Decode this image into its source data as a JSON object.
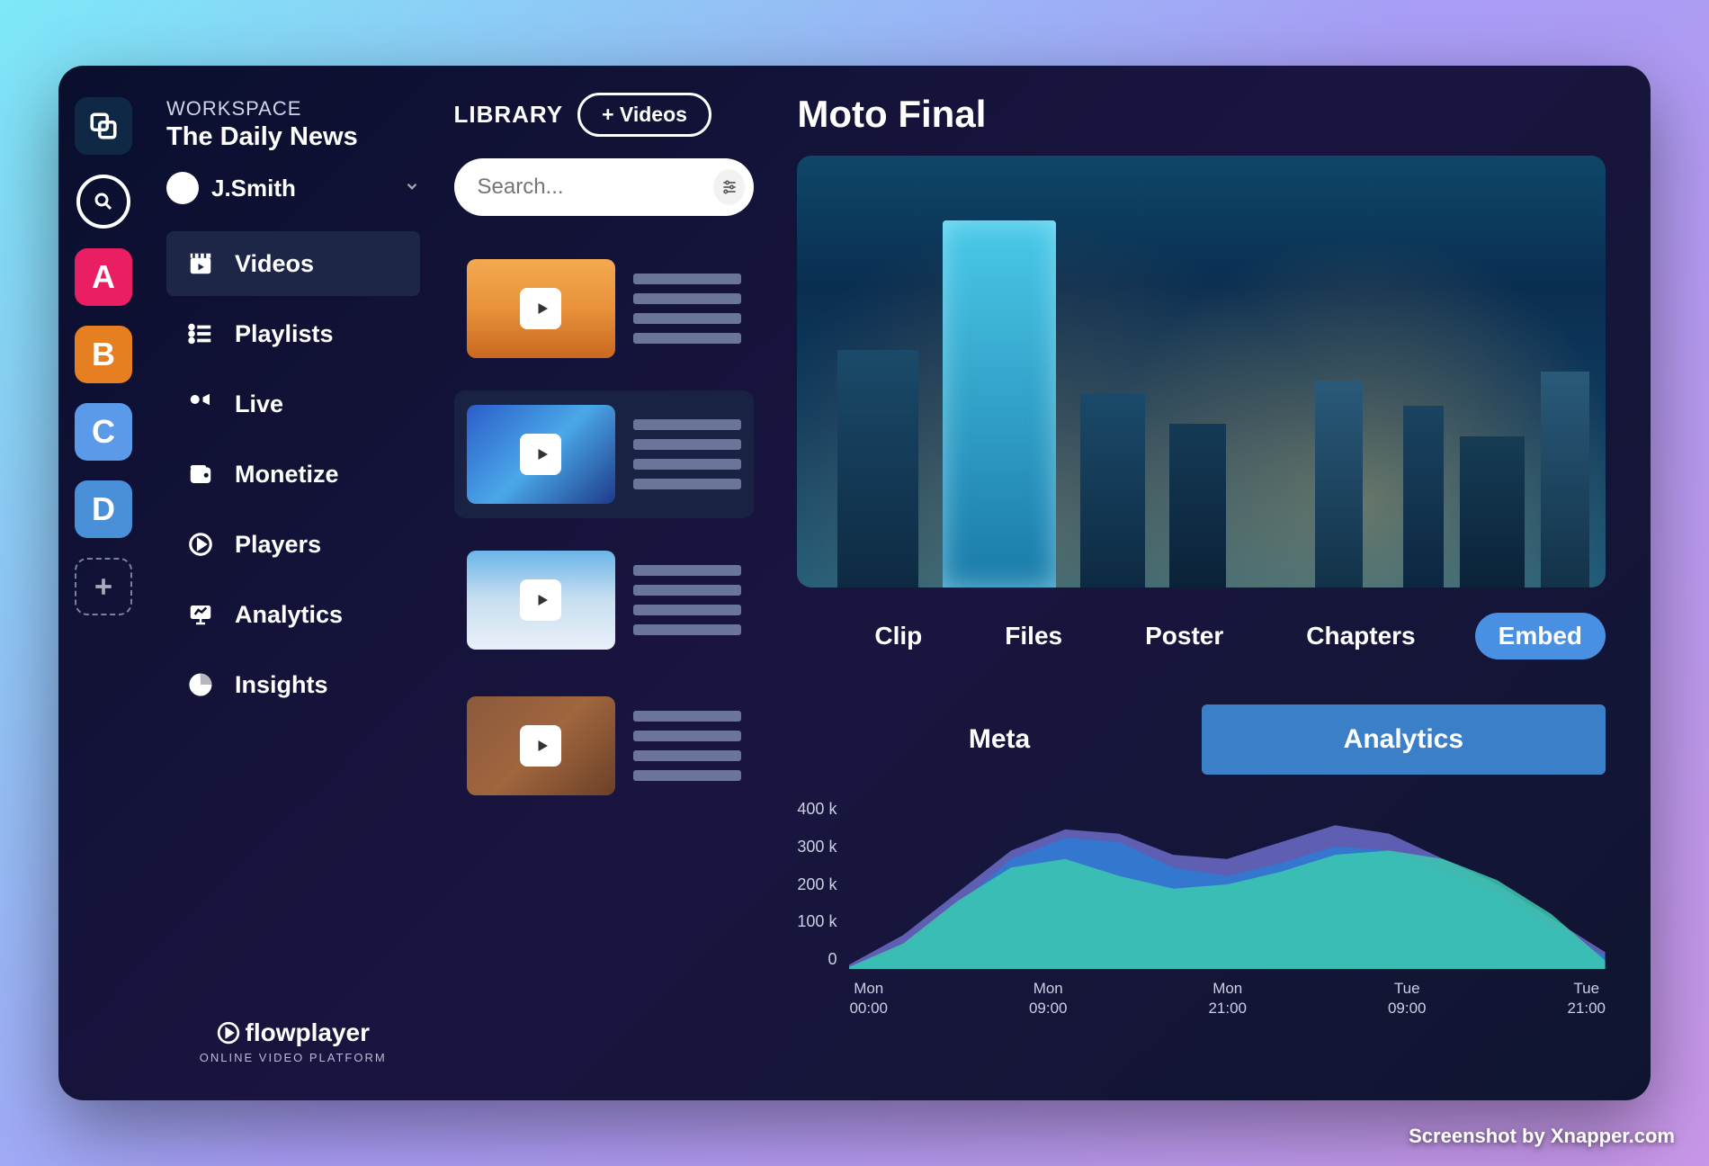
{
  "rail": {
    "items": [
      "A",
      "B",
      "C",
      "D"
    ]
  },
  "workspace": {
    "label": "WORKSPACE",
    "title": "The Daily News",
    "user": "J.Smith"
  },
  "nav": {
    "items": [
      {
        "label": "Videos",
        "icon": "clapperboard-icon",
        "active": true
      },
      {
        "label": "Playlists",
        "icon": "list-icon"
      },
      {
        "label": "Live",
        "icon": "live-icon"
      },
      {
        "label": "Monetize",
        "icon": "wallet-icon"
      },
      {
        "label": "Players",
        "icon": "play-circle-icon"
      },
      {
        "label": "Analytics",
        "icon": "presentation-icon"
      },
      {
        "label": "Insights",
        "icon": "pie-icon"
      }
    ]
  },
  "brand": {
    "name": "flowplayer",
    "tagline": "ONLINE VIDEO PLATFORM"
  },
  "library": {
    "title": "LIBRARY",
    "add_button": "+ Videos",
    "search_placeholder": "Search..."
  },
  "video": {
    "title": "Moto Final",
    "tabs": [
      "Clip",
      "Files",
      "Poster",
      "Chapters",
      "Embed"
    ],
    "active_tab": "Embed",
    "detail_tabs": [
      "Meta",
      "Analytics"
    ],
    "active_detail_tab": "Analytics"
  },
  "chart_data": {
    "type": "area",
    "title": "",
    "xlabel": "",
    "ylabel": "",
    "ylim": [
      0,
      400000
    ],
    "y_ticks": [
      "400 k",
      "300 k",
      "200 k",
      "100 k",
      "0"
    ],
    "x_ticks": [
      "Mon\n00:00",
      "Mon\n09:00",
      "Mon\n21:00",
      "Tue\n09:00",
      "Tue\n21:00"
    ],
    "series": [
      {
        "name": "series-purple",
        "color": "#6b6bc9",
        "values": [
          10000,
          80000,
          180000,
          280000,
          330000,
          320000,
          270000,
          260000,
          300000,
          340000,
          320000,
          260000,
          200000,
          120000,
          40000
        ]
      },
      {
        "name": "series-blue",
        "color": "#2c7bd4",
        "values": [
          5000,
          50000,
          150000,
          260000,
          310000,
          300000,
          240000,
          220000,
          250000,
          290000,
          280000,
          230000,
          180000,
          100000,
          30000
        ]
      },
      {
        "name": "series-teal",
        "color": "#3bc9b0",
        "values": [
          5000,
          60000,
          160000,
          240000,
          260000,
          220000,
          190000,
          200000,
          230000,
          270000,
          280000,
          260000,
          210000,
          130000,
          20000
        ]
      }
    ]
  },
  "watermark": "Screenshot by Xnapper.com"
}
